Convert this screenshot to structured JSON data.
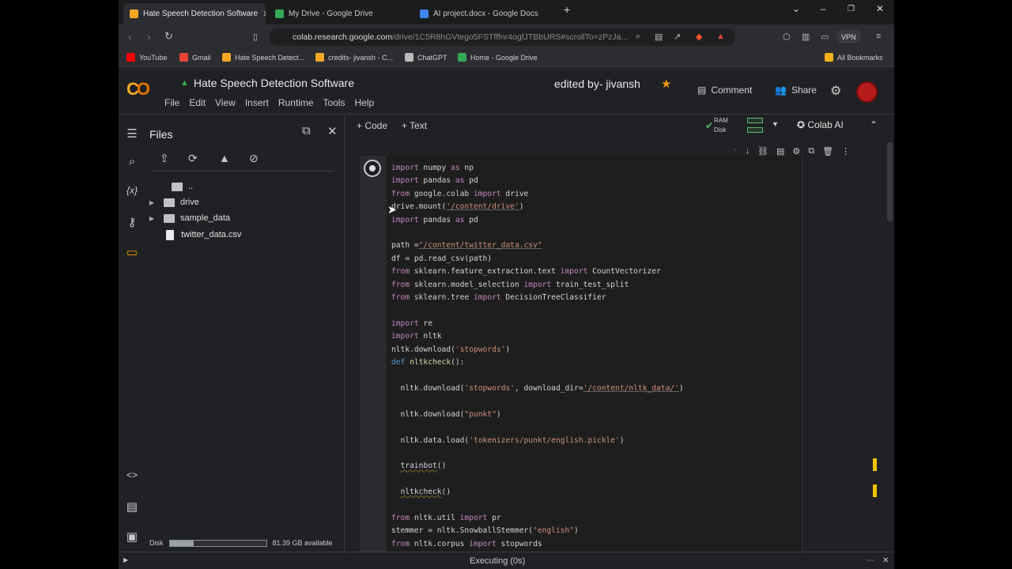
{
  "tabs": [
    {
      "label": "Hate Speech Detection Software",
      "favicon_color": "#f9a825",
      "active": true
    },
    {
      "label": "My Drive - Google Drive",
      "favicon_color": "#34a853",
      "active": false
    },
    {
      "label": "AI project.docx - Google Docs",
      "favicon_color": "#4285f4",
      "active": false
    }
  ],
  "url": {
    "host": "colab.research.google.com",
    "path": "/drive/1C5R8hGVtego5FSTfffnr4ogfJTBbURS#scrollTo=zPzJa..."
  },
  "vpn_label": "VPN",
  "bookmarks": [
    {
      "label": "YouTube",
      "color": "#ff0000"
    },
    {
      "label": "Gmail",
      "color": "#ea4335"
    },
    {
      "label": "Hate Speech Detect...",
      "color": "#f9a825"
    },
    {
      "label": "credits- jivansh - C...",
      "color": "#f9a825"
    },
    {
      "label": "ChatGPT",
      "color": "#bbbbbb"
    },
    {
      "label": "Home - Google Drive",
      "color": "#34a853"
    }
  ],
  "all_bookmarks": "All Bookmarks",
  "colab": {
    "logo": "CO",
    "title": "Hate Speech Detection Software",
    "menus": [
      "File",
      "Edit",
      "View",
      "Insert",
      "Runtime",
      "Tools",
      "Help"
    ],
    "edited_by": "edited by- jivansh",
    "comment": "Comment",
    "share": "Share"
  },
  "files_panel": {
    "title": "Files",
    "tree": [
      {
        "name": "..",
        "type": "up"
      },
      {
        "name": "drive",
        "type": "folder"
      },
      {
        "name": "sample_data",
        "type": "folder"
      },
      {
        "name": "twitter_data.csv",
        "type": "file"
      }
    ],
    "disk_label": "Disk",
    "disk_available": "81.39 GB available",
    "disk_used_fraction": 0.25
  },
  "toolbar": {
    "code": "+ Code",
    "text": "+ Text",
    "ram": "RAM",
    "disk": "Disk",
    "colab_ai": "Colab AI"
  },
  "status": "Executing (0s)"
}
